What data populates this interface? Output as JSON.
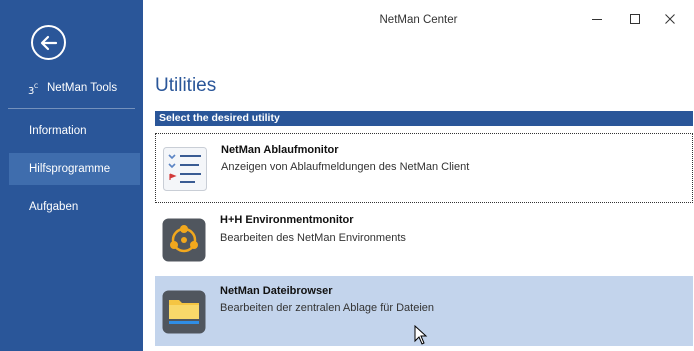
{
  "window": {
    "title": "NetMan Center",
    "controls": [
      "minimize",
      "maximize",
      "close"
    ]
  },
  "sidebar": {
    "back_icon": "back-arrow-icon",
    "app_name": "NetMan Tools",
    "items": [
      {
        "label": "Information",
        "active": false
      },
      {
        "label": "Hilfsprogramme",
        "active": true
      },
      {
        "label": "Aufgaben",
        "active": false
      }
    ]
  },
  "main": {
    "title": "Utilities",
    "section_label": "Select the desired utility",
    "utilities": [
      {
        "title": "NetMan Ablaufmonitor",
        "description": "Anzeigen von Ablaufmeldungen des NetMan Client",
        "icon": "list-monitor-icon",
        "state": "focused"
      },
      {
        "title": "H+H Environmentmonitor",
        "description": "Bearbeiten des NetMan Environments",
        "icon": "environment-network-icon",
        "state": "normal"
      },
      {
        "title": "NetMan Dateibrowser",
        "description": "Bearbeiten der zentralen Ablage für Dateien",
        "icon": "folder-browser-icon",
        "state": "selected"
      }
    ]
  },
  "colors": {
    "sidebar_bg": "#2a5699",
    "sidebar_active": "#3f6dad",
    "accent": "#2a5699",
    "selected_row": "#c3d4ec",
    "env_icon": "#f2a81d"
  }
}
